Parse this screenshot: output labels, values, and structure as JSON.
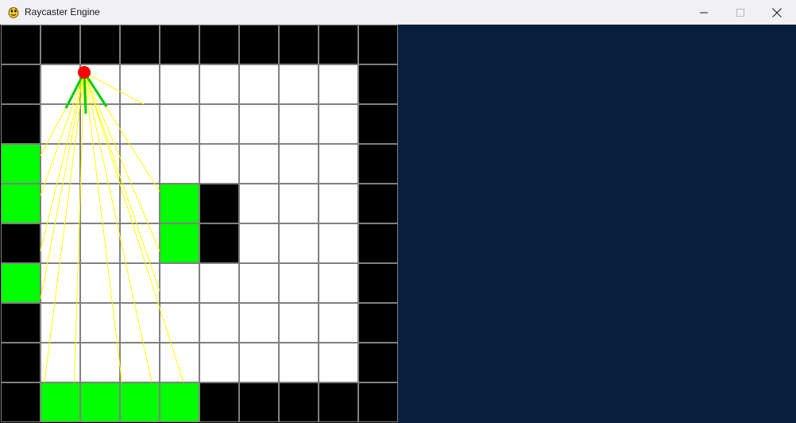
{
  "window": {
    "title": "Raycaster Engine",
    "icon": "pygame-snake-icon",
    "controls": [
      "minimize-icon",
      "maximize-icon",
      "close-icon"
    ]
  },
  "colors": {
    "wall": "#000000",
    "floor": "#ffffff",
    "hit_wall": "#00ff00",
    "grid_line": "#808080",
    "ray": "#ffff00",
    "player": "#ff0000",
    "fov_lines": "#00cc00",
    "view_background": "#08203e"
  },
  "map": {
    "rows": 10,
    "cols": 10,
    "cells": [
      [
        1,
        1,
        1,
        1,
        1,
        1,
        1,
        1,
        1,
        1
      ],
      [
        1,
        0,
        0,
        0,
        0,
        0,
        0,
        0,
        0,
        1
      ],
      [
        1,
        0,
        0,
        0,
        0,
        0,
        0,
        0,
        0,
        1
      ],
      [
        2,
        0,
        0,
        0,
        0,
        0,
        0,
        0,
        0,
        1
      ],
      [
        2,
        0,
        0,
        0,
        2,
        1,
        0,
        0,
        0,
        1
      ],
      [
        1,
        0,
        0,
        0,
        2,
        1,
        0,
        0,
        0,
        1
      ],
      [
        2,
        0,
        0,
        0,
        0,
        0,
        0,
        0,
        0,
        1
      ],
      [
        1,
        0,
        0,
        0,
        0,
        0,
        0,
        0,
        0,
        1
      ],
      [
        1,
        0,
        0,
        0,
        0,
        0,
        0,
        0,
        0,
        1
      ],
      [
        1,
        2,
        2,
        2,
        2,
        1,
        1,
        1,
        1,
        1
      ]
    ]
  },
  "player": {
    "cell_x": 2.1,
    "cell_y": 1.2,
    "facing": "down"
  },
  "rays": [
    [
      1.0,
      6.9
    ],
    [
      1.0,
      5.7
    ],
    [
      1.0,
      4.3
    ],
    [
      1.0,
      3.3
    ],
    [
      1.1,
      9.0
    ],
    [
      1.85,
      9.0
    ],
    [
      3.05,
      9.0
    ],
    [
      3.8,
      9.0
    ],
    [
      4.6,
      9.0
    ],
    [
      4.0,
      6.7
    ],
    [
      4.0,
      5.7
    ],
    [
      4.0,
      4.2
    ],
    [
      3.6,
      2.0
    ]
  ]
}
